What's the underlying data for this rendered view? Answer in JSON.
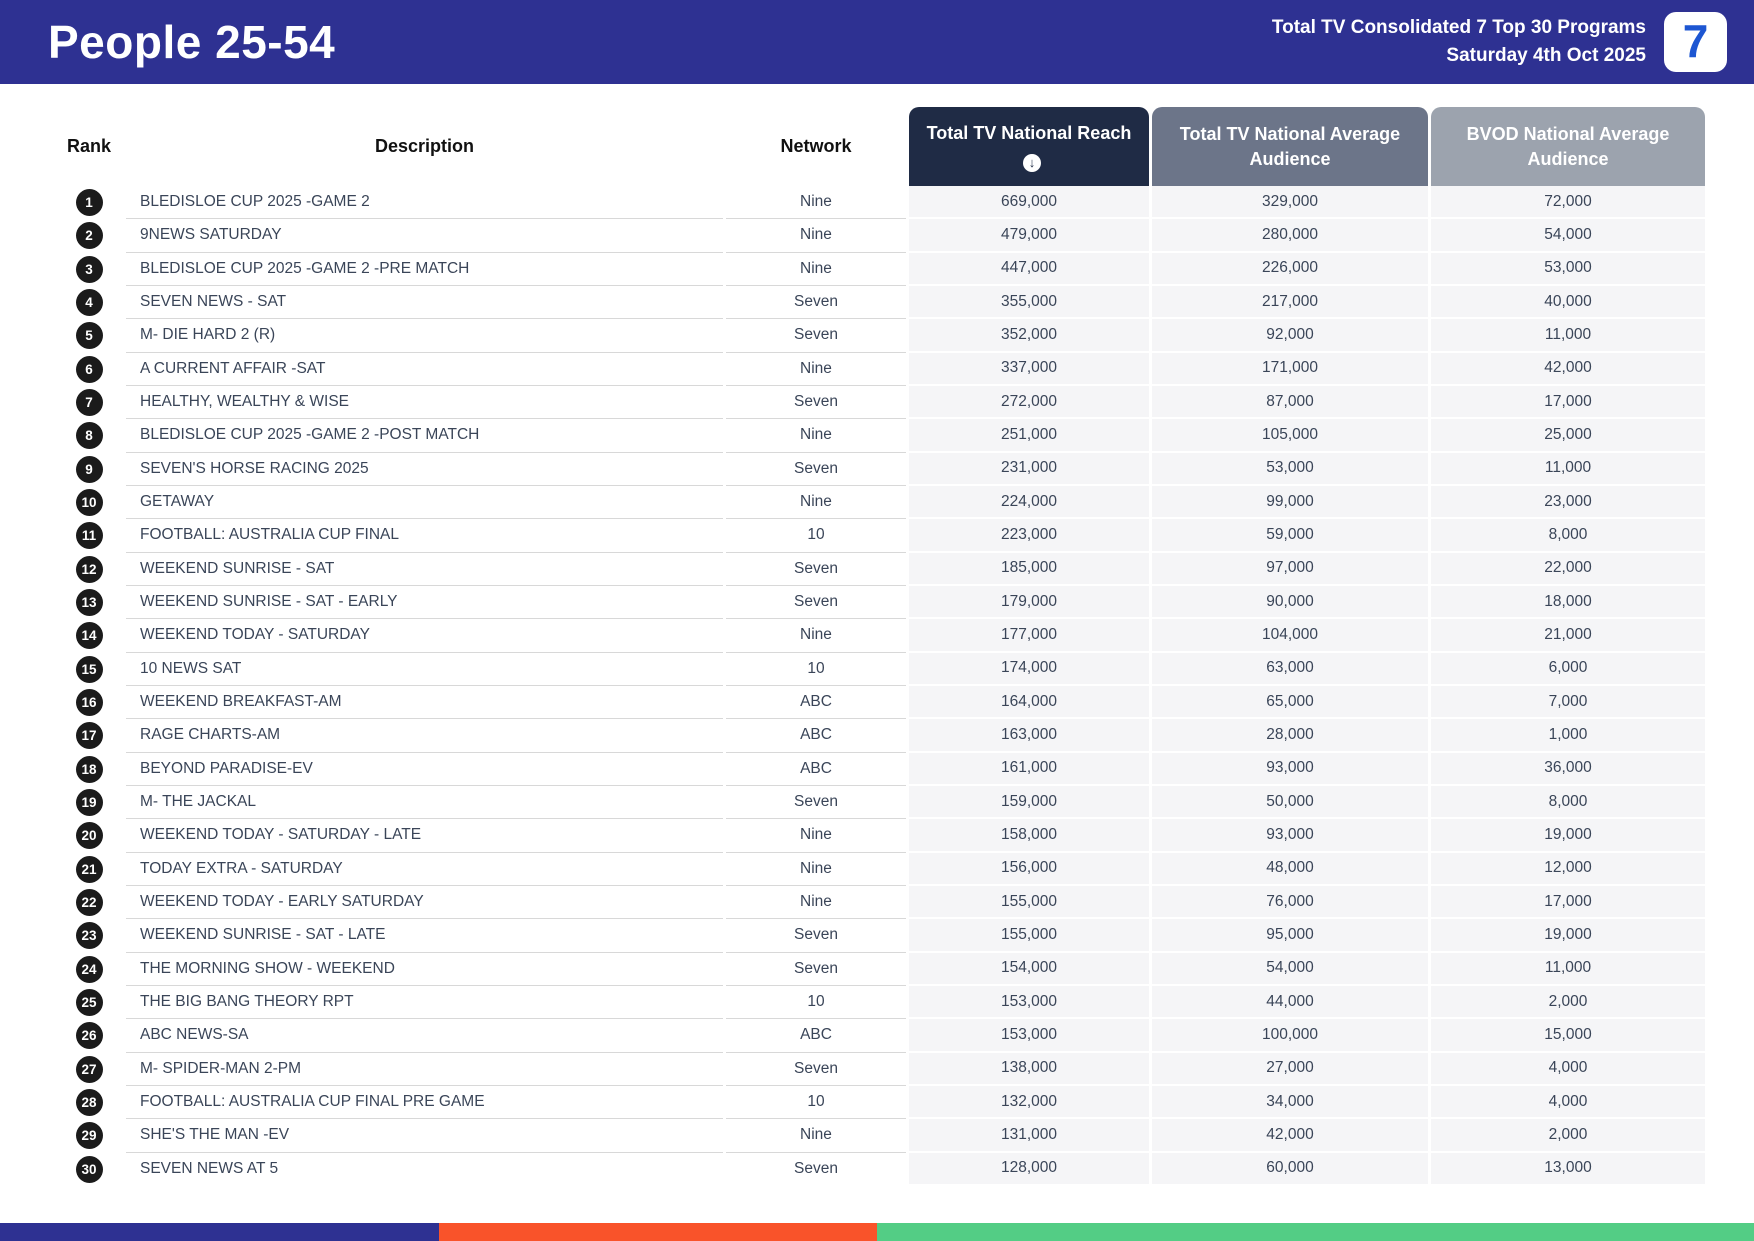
{
  "header": {
    "title": "People 25-54",
    "report_title": "Total TV Consolidated 7 Top 30 Programs",
    "report_date": "Saturday 4th Oct 2025",
    "logo_text": "7",
    "bar_color": "#2e3192"
  },
  "table": {
    "columns": {
      "rank": "Rank",
      "description": "Description",
      "network": "Network",
      "reach": "Total TV National Reach",
      "avg_audience": "Total TV National Average Audience",
      "bvod_audience": "BVOD National Average Audience"
    },
    "sort_icon": "down-arrow-circle",
    "sort_glyph": "↓",
    "header_colors": {
      "reach": "#1f2b45",
      "avg_audience": "#6c7589",
      "bvod_audience": "#9ca3ae"
    },
    "rows": [
      {
        "rank": "1",
        "description": "BLEDISLOE CUP 2025 -GAME 2",
        "network": "Nine",
        "reach": "669,000",
        "avg_audience": "329,000",
        "bvod_audience": "72,000"
      },
      {
        "rank": "2",
        "description": "9NEWS SATURDAY",
        "network": "Nine",
        "reach": "479,000",
        "avg_audience": "280,000",
        "bvod_audience": "54,000"
      },
      {
        "rank": "3",
        "description": "BLEDISLOE CUP 2025 -GAME 2 -PRE MATCH",
        "network": "Nine",
        "reach": "447,000",
        "avg_audience": "226,000",
        "bvod_audience": "53,000"
      },
      {
        "rank": "4",
        "description": "SEVEN NEWS - SAT",
        "network": "Seven",
        "reach": "355,000",
        "avg_audience": "217,000",
        "bvod_audience": "40,000"
      },
      {
        "rank": "5",
        "description": "M- DIE HARD 2 (R)",
        "network": "Seven",
        "reach": "352,000",
        "avg_audience": "92,000",
        "bvod_audience": "11,000"
      },
      {
        "rank": "6",
        "description": "A CURRENT AFFAIR -SAT",
        "network": "Nine",
        "reach": "337,000",
        "avg_audience": "171,000",
        "bvod_audience": "42,000"
      },
      {
        "rank": "7",
        "description": "HEALTHY, WEALTHY & WISE",
        "network": "Seven",
        "reach": "272,000",
        "avg_audience": "87,000",
        "bvod_audience": "17,000"
      },
      {
        "rank": "8",
        "description": "BLEDISLOE CUP 2025 -GAME 2 -POST MATCH",
        "network": "Nine",
        "reach": "251,000",
        "avg_audience": "105,000",
        "bvod_audience": "25,000"
      },
      {
        "rank": "9",
        "description": "SEVEN'S HORSE RACING 2025",
        "network": "Seven",
        "reach": "231,000",
        "avg_audience": "53,000",
        "bvod_audience": "11,000"
      },
      {
        "rank": "10",
        "description": "GETAWAY",
        "network": "Nine",
        "reach": "224,000",
        "avg_audience": "99,000",
        "bvod_audience": "23,000"
      },
      {
        "rank": "11",
        "description": "FOOTBALL: AUSTRALIA CUP FINAL",
        "network": "10",
        "reach": "223,000",
        "avg_audience": "59,000",
        "bvod_audience": "8,000"
      },
      {
        "rank": "12",
        "description": "WEEKEND SUNRISE - SAT",
        "network": "Seven",
        "reach": "185,000",
        "avg_audience": "97,000",
        "bvod_audience": "22,000"
      },
      {
        "rank": "13",
        "description": "WEEKEND SUNRISE - SAT - EARLY",
        "network": "Seven",
        "reach": "179,000",
        "avg_audience": "90,000",
        "bvod_audience": "18,000"
      },
      {
        "rank": "14",
        "description": "WEEKEND TODAY - SATURDAY",
        "network": "Nine",
        "reach": "177,000",
        "avg_audience": "104,000",
        "bvod_audience": "21,000"
      },
      {
        "rank": "15",
        "description": "10 NEWS SAT",
        "network": "10",
        "reach": "174,000",
        "avg_audience": "63,000",
        "bvod_audience": "6,000"
      },
      {
        "rank": "16",
        "description": "WEEKEND BREAKFAST-AM",
        "network": "ABC",
        "reach": "164,000",
        "avg_audience": "65,000",
        "bvod_audience": "7,000"
      },
      {
        "rank": "17",
        "description": "RAGE CHARTS-AM",
        "network": "ABC",
        "reach": "163,000",
        "avg_audience": "28,000",
        "bvod_audience": "1,000"
      },
      {
        "rank": "18",
        "description": "BEYOND PARADISE-EV",
        "network": "ABC",
        "reach": "161,000",
        "avg_audience": "93,000",
        "bvod_audience": "36,000"
      },
      {
        "rank": "19",
        "description": "M- THE JACKAL",
        "network": "Seven",
        "reach": "159,000",
        "avg_audience": "50,000",
        "bvod_audience": "8,000"
      },
      {
        "rank": "20",
        "description": "WEEKEND TODAY - SATURDAY - LATE",
        "network": "Nine",
        "reach": "158,000",
        "avg_audience": "93,000",
        "bvod_audience": "19,000"
      },
      {
        "rank": "21",
        "description": "TODAY EXTRA - SATURDAY",
        "network": "Nine",
        "reach": "156,000",
        "avg_audience": "48,000",
        "bvod_audience": "12,000"
      },
      {
        "rank": "22",
        "description": "WEEKEND TODAY - EARLY SATURDAY",
        "network": "Nine",
        "reach": "155,000",
        "avg_audience": "76,000",
        "bvod_audience": "17,000"
      },
      {
        "rank": "23",
        "description": "WEEKEND SUNRISE - SAT - LATE",
        "network": "Seven",
        "reach": "155,000",
        "avg_audience": "95,000",
        "bvod_audience": "19,000"
      },
      {
        "rank": "24",
        "description": "THE MORNING SHOW - WEEKEND",
        "network": "Seven",
        "reach": "154,000",
        "avg_audience": "54,000",
        "bvod_audience": "11,000"
      },
      {
        "rank": "25",
        "description": "THE BIG BANG THEORY RPT",
        "network": "10",
        "reach": "153,000",
        "avg_audience": "44,000",
        "bvod_audience": "2,000"
      },
      {
        "rank": "26",
        "description": "ABC NEWS-SA",
        "network": "ABC",
        "reach": "153,000",
        "avg_audience": "100,000",
        "bvod_audience": "15,000"
      },
      {
        "rank": "27",
        "description": "M- SPIDER-MAN 2-PM",
        "network": "Seven",
        "reach": "138,000",
        "avg_audience": "27,000",
        "bvod_audience": "4,000"
      },
      {
        "rank": "28",
        "description": "FOOTBALL: AUSTRALIA CUP FINAL PRE GAME",
        "network": "10",
        "reach": "132,000",
        "avg_audience": "34,000",
        "bvod_audience": "4,000"
      },
      {
        "rank": "29",
        "description": "SHE'S THE MAN -EV",
        "network": "Nine",
        "reach": "131,000",
        "avg_audience": "42,000",
        "bvod_audience": "2,000"
      },
      {
        "rank": "30",
        "description": "SEVEN NEWS AT 5",
        "network": "Seven",
        "reach": "128,000",
        "avg_audience": "60,000",
        "bvod_audience": "13,000"
      }
    ]
  },
  "footer": {
    "stripe_colors": [
      "#2e3192",
      "#f9532a",
      "#53cd85"
    ]
  }
}
